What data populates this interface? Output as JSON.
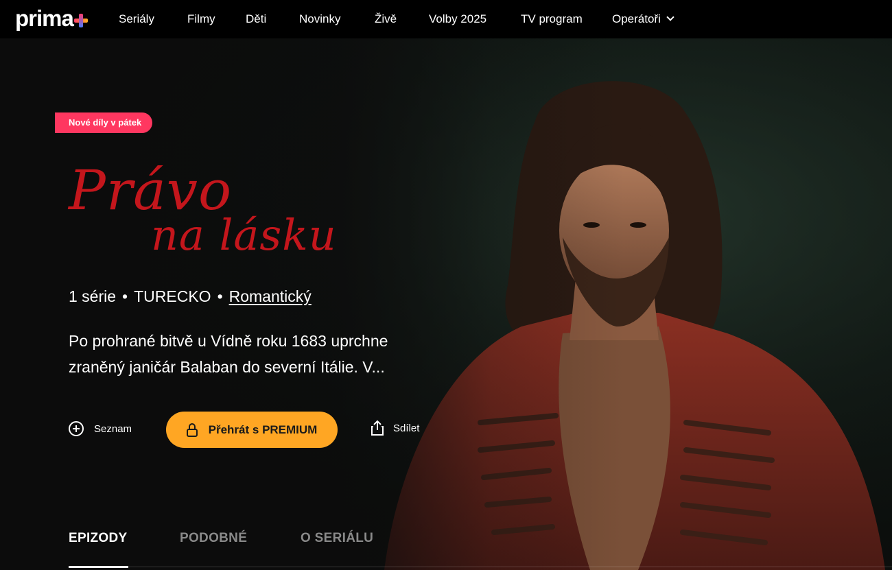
{
  "nav": {
    "logo_text": "prima",
    "items": [
      {
        "label": "Seriály"
      },
      {
        "label": "Filmy"
      },
      {
        "label": "Děti"
      },
      {
        "label": "Novinky"
      },
      {
        "label": "Živě"
      },
      {
        "label": "Volby 2025"
      },
      {
        "label": "TV program"
      },
      {
        "label": "Operátoři"
      }
    ]
  },
  "hero": {
    "badge": "Nové díly v pátek",
    "title_line1": "Právo",
    "title_line2": "na lásku",
    "meta": {
      "series": "1 série",
      "country": "TURECKO",
      "genre": "Romantický"
    },
    "description": "Po prohrané bitvě u Vídně roku 1683 uprchne zraněný janičár Balaban do severní Itálie. V...",
    "actions": {
      "list_label": "Seznam",
      "play_label": "Přehrát s PREMIUM",
      "share_label": "Sdílet"
    }
  },
  "tabs": [
    {
      "label": "EPIZODY",
      "active": true
    },
    {
      "label": "PODOBNÉ",
      "active": false
    },
    {
      "label": "O SERIÁLU",
      "active": false
    }
  ],
  "colors": {
    "badge": "#ff3760",
    "play_button": "#ffa623",
    "title": "#c4161c",
    "background": "#0d0d0d"
  },
  "icons": [
    "plus-circle-icon",
    "lock-icon",
    "share-icon",
    "chevron-down-icon"
  ]
}
